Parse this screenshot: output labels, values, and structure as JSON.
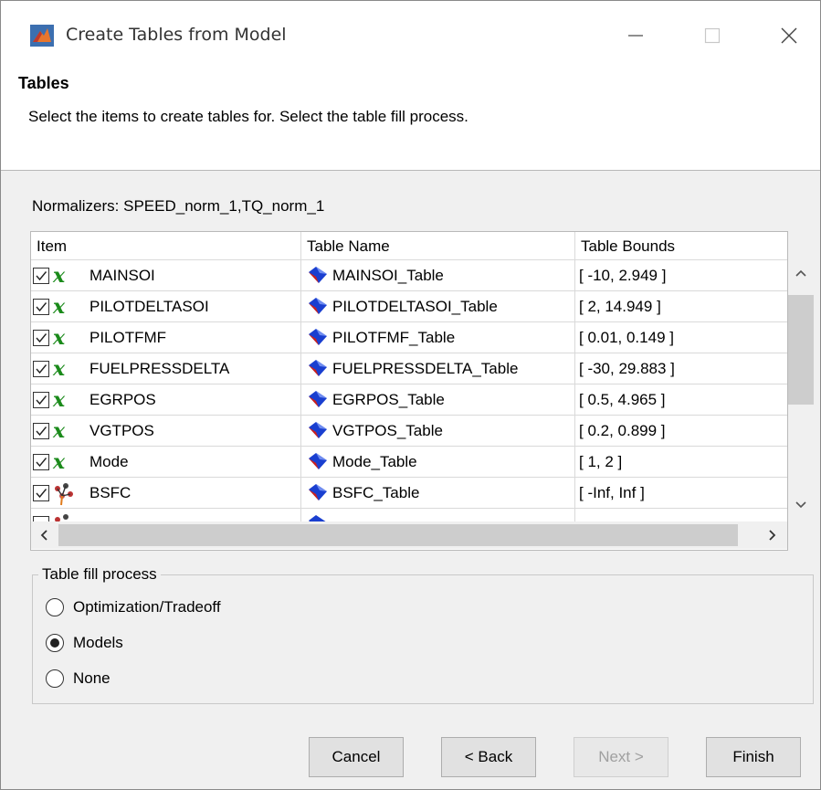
{
  "window": {
    "title": "Create Tables from Model",
    "icon": "matlab-icon"
  },
  "header": {
    "title": "Tables",
    "description": "Select the items to create tables for. Select the table fill process."
  },
  "normalizers": "Normalizers: SPEED_norm_1,TQ_norm_1",
  "table": {
    "columns": [
      "Item",
      "Table Name",
      "Table Bounds"
    ],
    "rows": [
      {
        "checked": true,
        "icon": "variable-x-icon",
        "item": "MAINSOI",
        "table_name": "MAINSOI_Table",
        "bounds": "[ -10, 2.949 ]"
      },
      {
        "checked": true,
        "icon": "variable-x-icon",
        "item": "PILOTDELTASOI",
        "table_name": "PILOTDELTASOI_Table",
        "bounds": "[ 2, 14.949 ]"
      },
      {
        "checked": true,
        "icon": "variable-x-icon",
        "item": "PILOTFMF",
        "table_name": "PILOTFMF_Table",
        "bounds": "[ 0.01, 0.149 ]"
      },
      {
        "checked": true,
        "icon": "variable-x-icon",
        "item": "FUELPRESSDELTA",
        "table_name": "FUELPRESSDELTA_Table",
        "bounds": "[ -30, 29.883 ]"
      },
      {
        "checked": true,
        "icon": "variable-x-icon",
        "item": "EGRPOS",
        "table_name": "EGRPOS_Table",
        "bounds": "[ 0.5, 4.965 ]"
      },
      {
        "checked": true,
        "icon": "variable-x-icon",
        "item": "VGTPOS",
        "table_name": "VGTPOS_Table",
        "bounds": "[ 0.2, 0.899 ]"
      },
      {
        "checked": true,
        "icon": "variable-x-icon",
        "item": "Mode",
        "table_name": "Mode_Table",
        "bounds": "[ 1, 2 ]"
      },
      {
        "checked": true,
        "icon": "model-icon",
        "item": "BSFC",
        "table_name": "BSFC_Table",
        "bounds": "[ -Inf, Inf ]"
      }
    ]
  },
  "fill_process": {
    "legend": "Table fill process",
    "options": [
      "Optimization/Tradeoff",
      "Models",
      "None"
    ],
    "selected": "Models"
  },
  "buttons": {
    "cancel": "Cancel",
    "back": "< Back",
    "next": "Next >",
    "finish": "Finish"
  }
}
